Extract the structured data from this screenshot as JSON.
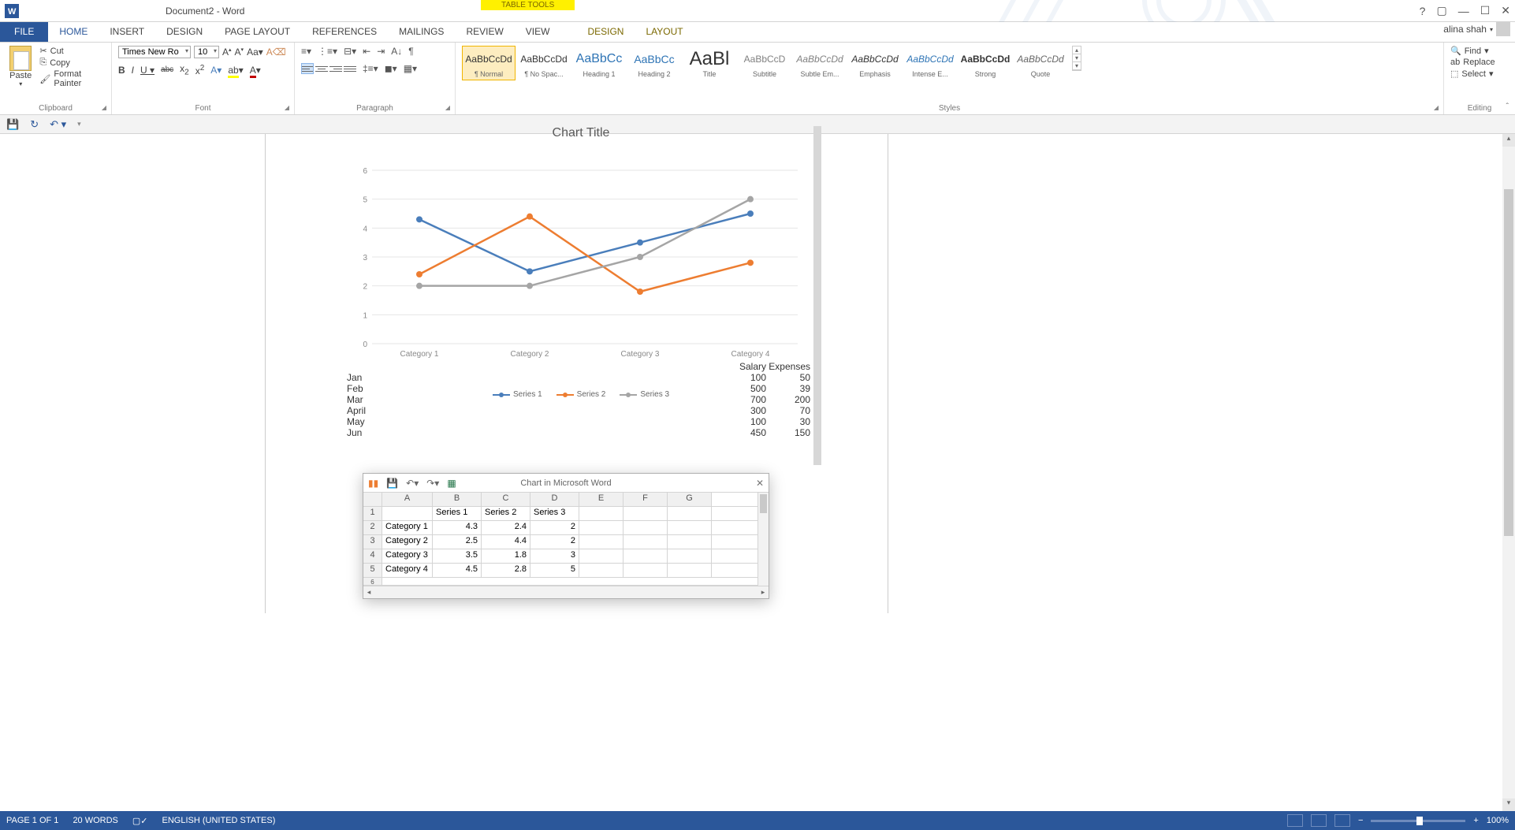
{
  "titlebar": {
    "doc_title": "Document2 - Word",
    "table_tools": "TABLE TOOLS",
    "help": "?"
  },
  "tabs": {
    "file": "FILE",
    "home": "HOME",
    "insert": "INSERT",
    "design": "DESIGN",
    "page_layout": "PAGE LAYOUT",
    "references": "REFERENCES",
    "mailings": "MAILINGS",
    "review": "REVIEW",
    "view": "VIEW",
    "ctx_design": "DESIGN",
    "ctx_layout": "LAYOUT"
  },
  "user": {
    "name": "alina shah"
  },
  "clipboard": {
    "paste": "Paste",
    "cut": "Cut",
    "copy": "Copy",
    "format_painter": "Format Painter",
    "label": "Clipboard"
  },
  "font": {
    "name": "Times New Ro",
    "size": "10",
    "label": "Font"
  },
  "paragraph": {
    "label": "Paragraph"
  },
  "styles": {
    "label": "Styles",
    "items": [
      {
        "preview": "AaBbCcDd",
        "name": "¶ Normal",
        "cls": ""
      },
      {
        "preview": "AaBbCcDd",
        "name": "¶ No Spac...",
        "cls": ""
      },
      {
        "preview": "AaBbCc",
        "name": "Heading 1",
        "cls": "h1"
      },
      {
        "preview": "AaBbCc",
        "name": "Heading 2",
        "cls": "h2"
      },
      {
        "preview": "AaBl",
        "name": "Title",
        "cls": "title"
      },
      {
        "preview": "AaBbCcD",
        "name": "Subtitle",
        "cls": "sub"
      },
      {
        "preview": "AaBbCcDd",
        "name": "Subtle Em...",
        "cls": "subem"
      },
      {
        "preview": "AaBbCcDd",
        "name": "Emphasis",
        "cls": "em"
      },
      {
        "preview": "AaBbCcDd",
        "name": "Intense E...",
        "cls": "int"
      },
      {
        "preview": "AaBbCcDd",
        "name": "Strong",
        "cls": "strong"
      },
      {
        "preview": "AaBbCcDd",
        "name": "Quote",
        "cls": "quote"
      }
    ]
  },
  "editing": {
    "find": "Find",
    "replace": "Replace",
    "select": "Select",
    "label": "Editing"
  },
  "chart_data": {
    "type": "line",
    "title": "Chart Title",
    "categories": [
      "Category 1",
      "Category 2",
      "Category 3",
      "Category 4"
    ],
    "series": [
      {
        "name": "Series 1",
        "values": [
          4.3,
          2.5,
          3.5,
          4.5
        ],
        "color": "#4a7ebb"
      },
      {
        "name": "Series 2",
        "values": [
          2.4,
          4.4,
          1.8,
          2.8
        ],
        "color": "#ed7d31"
      },
      {
        "name": "Series 3",
        "values": [
          2,
          2,
          3,
          5
        ],
        "color": "#a5a5a5"
      }
    ],
    "ylim": [
      0,
      6
    ],
    "yticks": [
      0,
      1,
      2,
      3,
      4,
      5,
      6
    ],
    "legend": [
      "Series 1",
      "Series 2",
      "Series 3"
    ]
  },
  "doc_table": {
    "header": {
      "c2": "Salary",
      "c3": "Expenses"
    },
    "rows": [
      {
        "m": "Jan",
        "s": "100",
        "e": "50"
      },
      {
        "m": "Feb",
        "s": "500",
        "e": "39"
      },
      {
        "m": "Mar",
        "s": "700",
        "e": "200"
      },
      {
        "m": "April",
        "s": "300",
        "e": "70"
      },
      {
        "m": "May",
        "s": "100",
        "e": "30"
      },
      {
        "m": "Jun",
        "s": "450",
        "e": "150"
      }
    ]
  },
  "mini_xl": {
    "title": "Chart in Microsoft Word",
    "cols": [
      "A",
      "B",
      "C",
      "D",
      "E",
      "F",
      "G"
    ],
    "headers": {
      "b": "Series 1",
      "c": "Series 2",
      "d": "Series 3"
    },
    "rows": [
      {
        "n": "2",
        "a": "Category 1",
        "b": "4.3",
        "c": "2.4",
        "d": "2"
      },
      {
        "n": "3",
        "a": "Category 2",
        "b": "2.5",
        "c": "4.4",
        "d": "2"
      },
      {
        "n": "4",
        "a": "Category 3",
        "b": "3.5",
        "c": "1.8",
        "d": "3"
      },
      {
        "n": "5",
        "a": "Category 4",
        "b": "4.5",
        "c": "2.8",
        "d": "5"
      }
    ]
  },
  "status": {
    "page": "PAGE 1 OF 1",
    "words": "20 WORDS",
    "lang": "ENGLISH (UNITED STATES)",
    "zoom": "100%"
  }
}
